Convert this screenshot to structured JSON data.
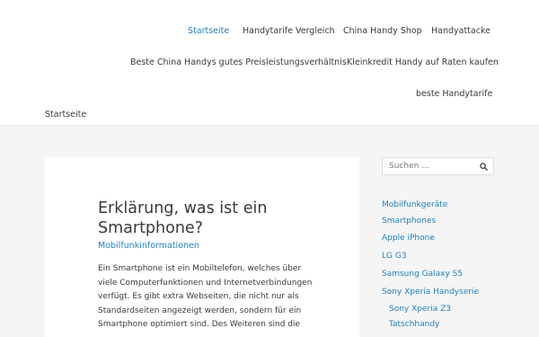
{
  "nav": {
    "items": [
      {
        "label": "Startseite",
        "active": true
      },
      {
        "label": "Handytarife Vergleich"
      },
      {
        "label": "China Handy Shop"
      },
      {
        "label": "Handyattacke"
      },
      {
        "label": "Beste China Handys gutes Preisleistungsverhältnis"
      },
      {
        "label": "Kleinkredit Handy auf Raten kaufen"
      },
      {
        "label": "beste Handytarife"
      }
    ]
  },
  "breadcrumb": "Startseite",
  "article": {
    "title": "Erklärung, was ist ein Smartphone?",
    "category": "Mobilfunkinformationen",
    "body": "Ein Smartphone ist ein Mobiltelefon, welches über viele Computerfunktionen und Internetverbindungen verfügt. Es gibt extra Webseiten, die nicht nur als Standardseiten angezeigt werden, sondern für ein Smartphone optimiert sind. Des Weiteren sind die"
  },
  "search": {
    "placeholder": "Suchen …",
    "value": ""
  },
  "sidebar": {
    "links": [
      {
        "label": "Mobilfunkgeräte"
      },
      {
        "label": "Smartphones"
      },
      {
        "label": "Apple iPhone"
      },
      {
        "label": "LG G3"
      },
      {
        "label": "Samsung Galaxy S5"
      },
      {
        "label": "Sony Xperia Handyserie"
      },
      {
        "label": "Sony Xperia Z3"
      },
      {
        "label": "Tatschhandy"
      }
    ]
  },
  "colors": {
    "accent": "#1f7fc1",
    "text": "#3a3a3a",
    "background": "#f5f5f5"
  }
}
